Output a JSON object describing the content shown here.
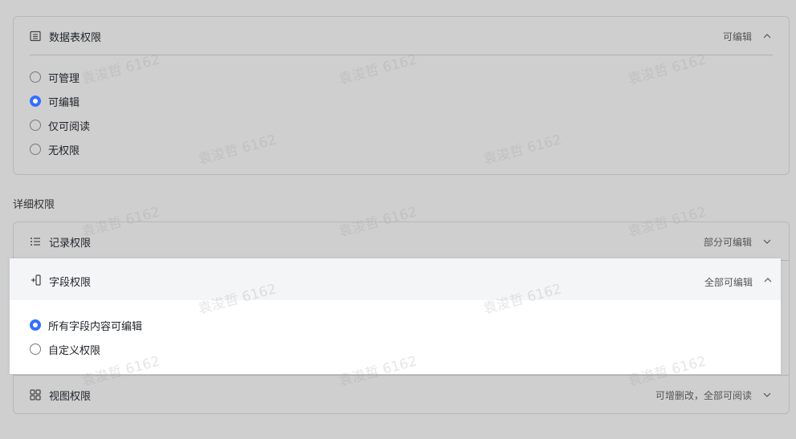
{
  "table_permission": {
    "title": "数据表权限",
    "value": "可编辑",
    "icon": "table-icon",
    "options": [
      {
        "label": "可管理",
        "selected": false
      },
      {
        "label": "可编辑",
        "selected": true
      },
      {
        "label": "仅可阅读",
        "selected": false
      },
      {
        "label": "无权限",
        "selected": false
      }
    ]
  },
  "detail_label": "详细权限",
  "record": {
    "title": "记录权限",
    "value": "部分可编辑",
    "icon": "list-icon"
  },
  "field": {
    "title": "字段权限",
    "value": "全部可编辑",
    "icon": "field-icon",
    "options": [
      {
        "label": "所有字段内容可编辑",
        "selected": true
      },
      {
        "label": "自定义权限",
        "selected": false
      }
    ]
  },
  "view": {
    "title": "视图权限",
    "value": "可增删改，全部可阅读",
    "icon": "grid-icon"
  },
  "watermark": "袁浚哲 6162",
  "colors": {
    "accent": "#3370ff",
    "overlay": "#cfcfcf"
  }
}
